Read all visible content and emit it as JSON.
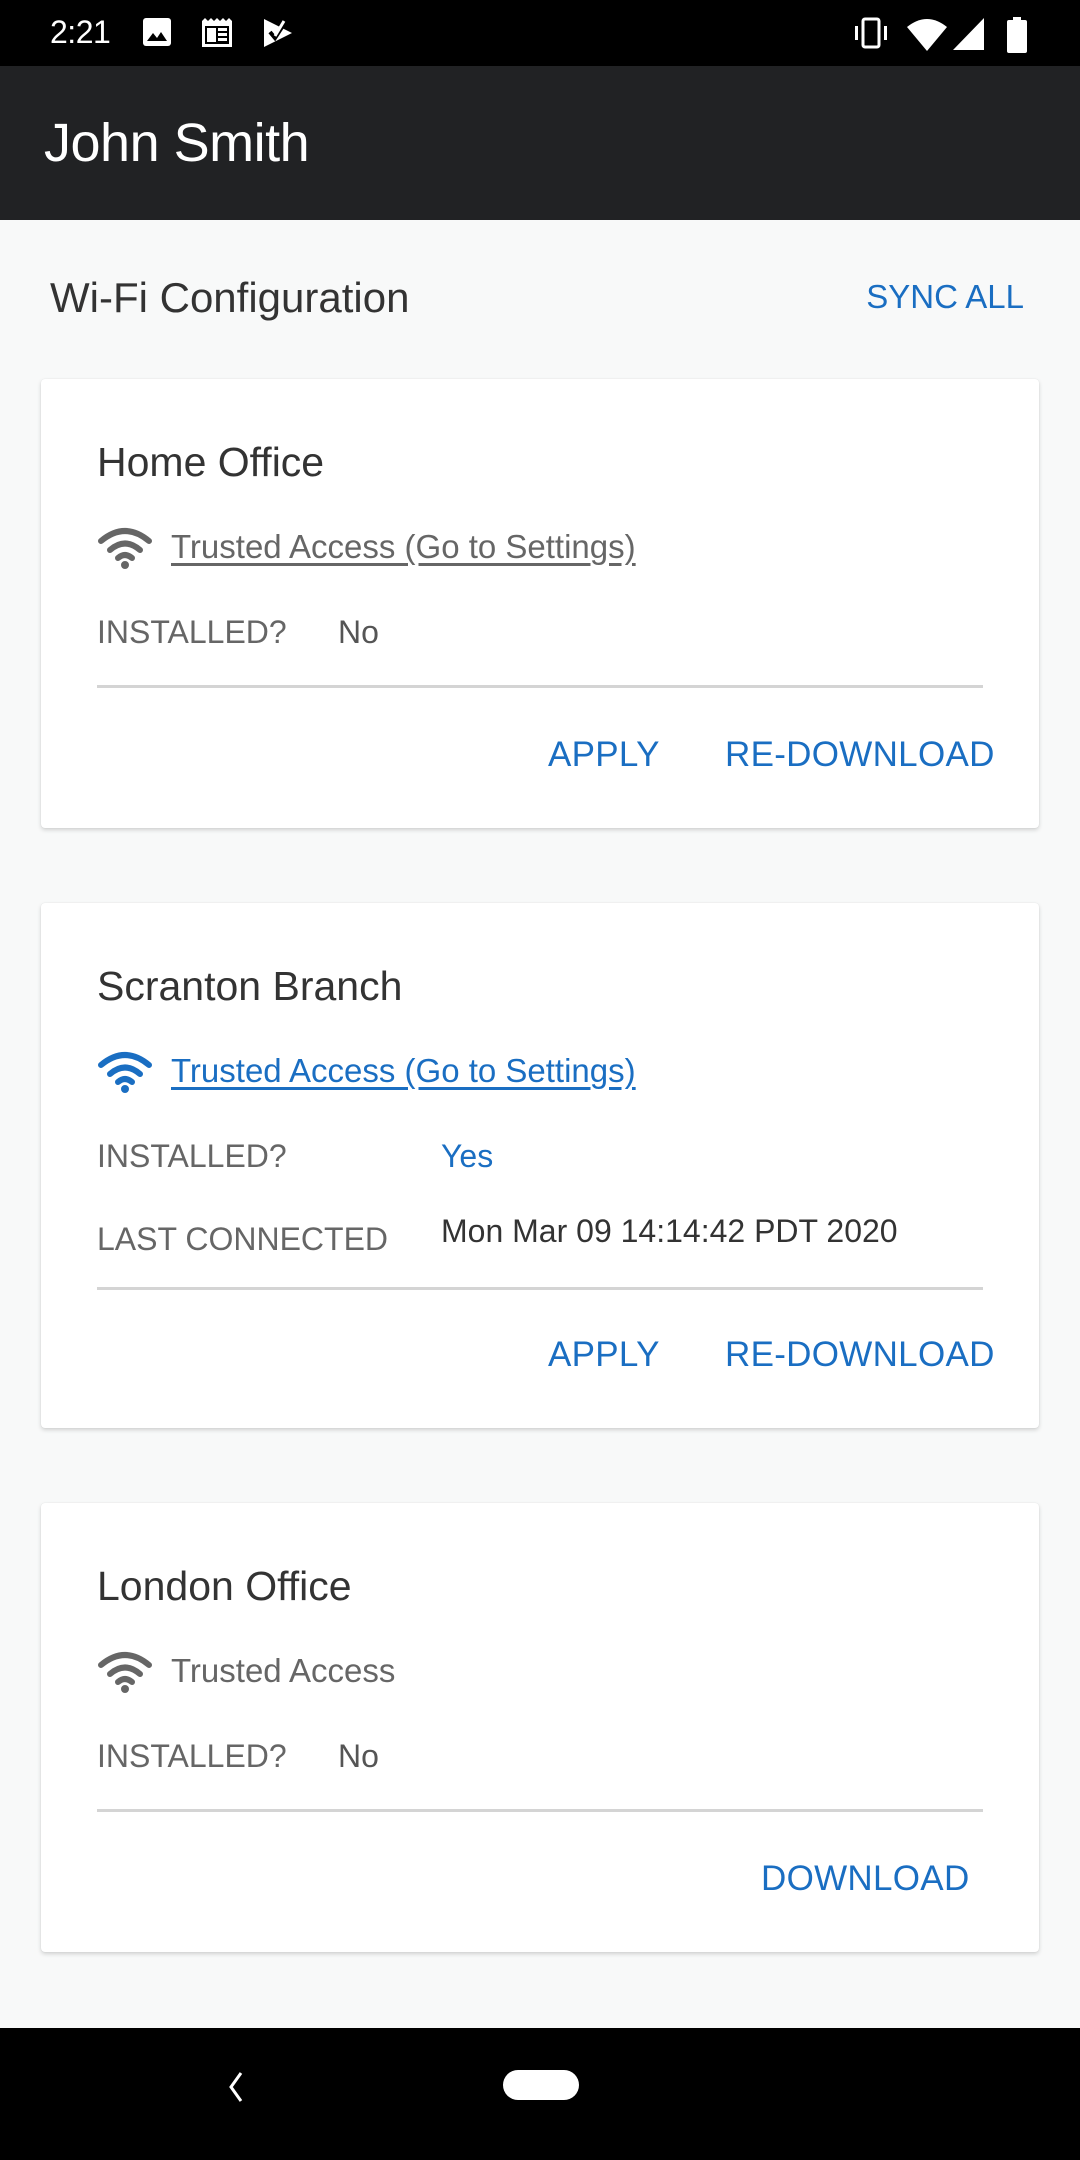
{
  "status_bar": {
    "time": "2:21",
    "left_icons": [
      "image-icon",
      "calendar-icon",
      "task-check-icon"
    ],
    "right_icons": [
      "vibrate-icon",
      "wifi-icon",
      "signal-icon",
      "battery-icon"
    ]
  },
  "app_bar": {
    "title": "John Smith"
  },
  "section": {
    "title": "Wi-Fi Configuration",
    "sync_all_label": "SYNC ALL"
  },
  "colors": {
    "accent": "#1a6ec2",
    "app_bar": "#212224",
    "background": "#f8f9f9"
  },
  "cards": [
    {
      "name": "Home Office",
      "access_text": "Trusted Access (Go to Settings)",
      "access_linked": true,
      "connected": false,
      "installed_label": "INSTALLED?",
      "installed_value": "No",
      "actions": [
        "APPLY",
        "RE-DOWNLOAD"
      ]
    },
    {
      "name": "Scranton Branch",
      "access_text": "Trusted Access (Go to Settings)",
      "access_linked": true,
      "connected": true,
      "installed_label": "INSTALLED?",
      "installed_value": "Yes",
      "last_connected_label": "LAST CONNECTED",
      "last_connected_value": "Mon Mar 09 14:14:42 PDT 2020",
      "actions": [
        "APPLY",
        "RE-DOWNLOAD"
      ]
    },
    {
      "name": "London Office",
      "access_text": "Trusted Access",
      "access_linked": false,
      "connected": false,
      "installed_label": "INSTALLED?",
      "installed_value": "No",
      "actions": [
        "DOWNLOAD"
      ]
    }
  ],
  "nav_bar": {
    "icons": [
      "back-icon",
      "home-pill-icon"
    ]
  }
}
